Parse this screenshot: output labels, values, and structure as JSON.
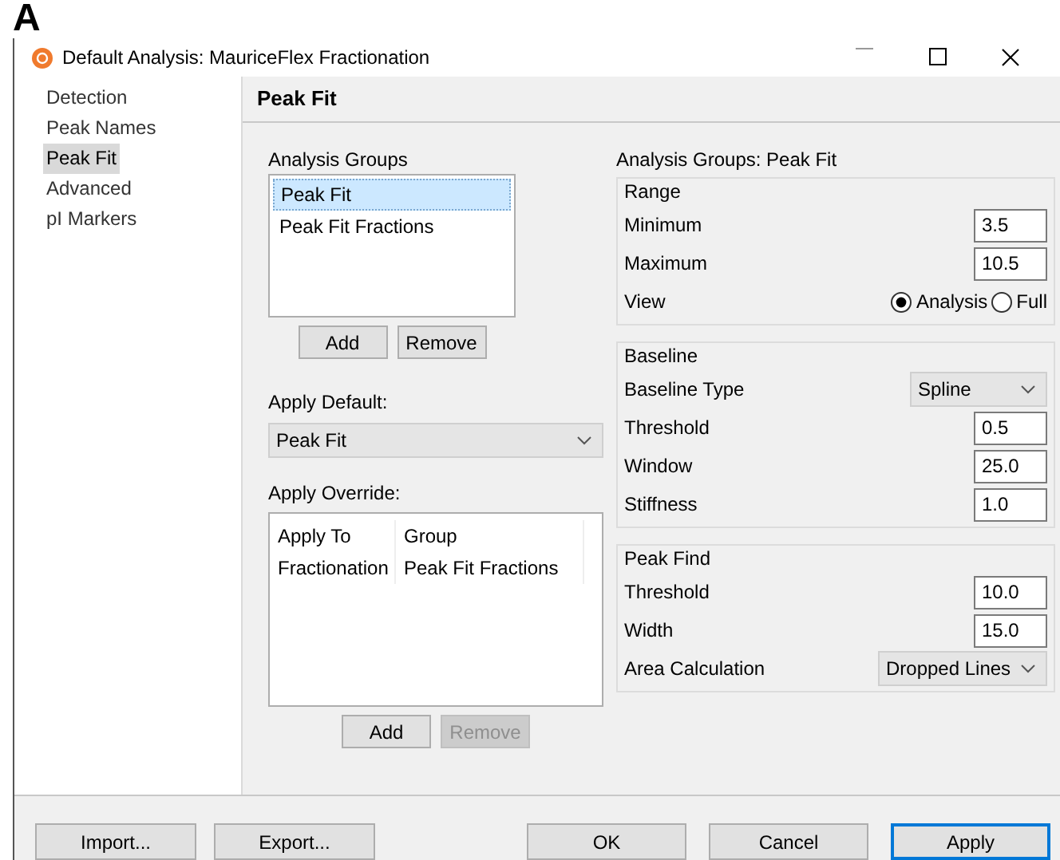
{
  "figure_label": "A",
  "window": {
    "title": "Default Analysis: MauriceFlex Fractionation"
  },
  "sidebar": {
    "items": [
      {
        "label": "Detection",
        "selected": false
      },
      {
        "label": "Peak Names",
        "selected": false
      },
      {
        "label": "Peak Fit",
        "selected": true
      },
      {
        "label": "Advanced",
        "selected": false
      },
      {
        "label": "pI Markers",
        "selected": false
      }
    ]
  },
  "header": "Peak Fit",
  "analysis_groups": {
    "label": "Analysis Groups",
    "items": [
      {
        "label": "Peak Fit",
        "selected": true
      },
      {
        "label": "Peak Fit Fractions",
        "selected": false
      }
    ],
    "buttons": [
      {
        "label": "Add",
        "disabled": false
      },
      {
        "label": "Remove",
        "disabled": false
      }
    ]
  },
  "apply_default": {
    "label": "Apply Default:",
    "value": "Peak Fit"
  },
  "apply_override": {
    "label": "Apply Override:",
    "columns": [
      "Apply To",
      "Group"
    ],
    "rows": [
      [
        "Fractionation",
        "Peak Fit Fractions"
      ]
    ],
    "buttons": [
      {
        "label": "Add",
        "disabled": false
      },
      {
        "label": "Remove",
        "disabled": true
      }
    ]
  },
  "settings": {
    "title": "Analysis Groups: Peak Fit",
    "sections": [
      {
        "title": "Range",
        "rows": [
          {
            "kind": "field",
            "label": "Minimum",
            "value": "3.5"
          },
          {
            "kind": "field",
            "label": "Maximum",
            "value": "10.5"
          },
          {
            "kind": "radio",
            "label": "View",
            "options": [
              {
                "label": "Analysis",
                "selected": true
              },
              {
                "label": "Full",
                "selected": false
              }
            ]
          }
        ]
      },
      {
        "title": "Baseline",
        "rows": [
          {
            "kind": "dropdown",
            "label": "Baseline Type",
            "value": "Spline"
          },
          {
            "kind": "field",
            "label": "Threshold",
            "value": "0.5"
          },
          {
            "kind": "field",
            "label": "Window",
            "value": "25.0"
          },
          {
            "kind": "field",
            "label": "Stiffness",
            "value": "1.0"
          }
        ]
      },
      {
        "title": "Peak Find",
        "rows": [
          {
            "kind": "field",
            "label": "Threshold",
            "value": "10.0"
          },
          {
            "kind": "field",
            "label": "Width",
            "value": "15.0"
          },
          {
            "kind": "dropdown",
            "label": "Area Calculation",
            "value": "Dropped Lines"
          }
        ]
      }
    ]
  },
  "footer": {
    "left_buttons": [
      {
        "label": "Import...",
        "default": false
      },
      {
        "label": "Export...",
        "default": false
      }
    ],
    "right_buttons": [
      {
        "label": "OK",
        "default": false
      },
      {
        "label": "Cancel",
        "default": false
      },
      {
        "label": "Apply",
        "default": true
      }
    ]
  }
}
